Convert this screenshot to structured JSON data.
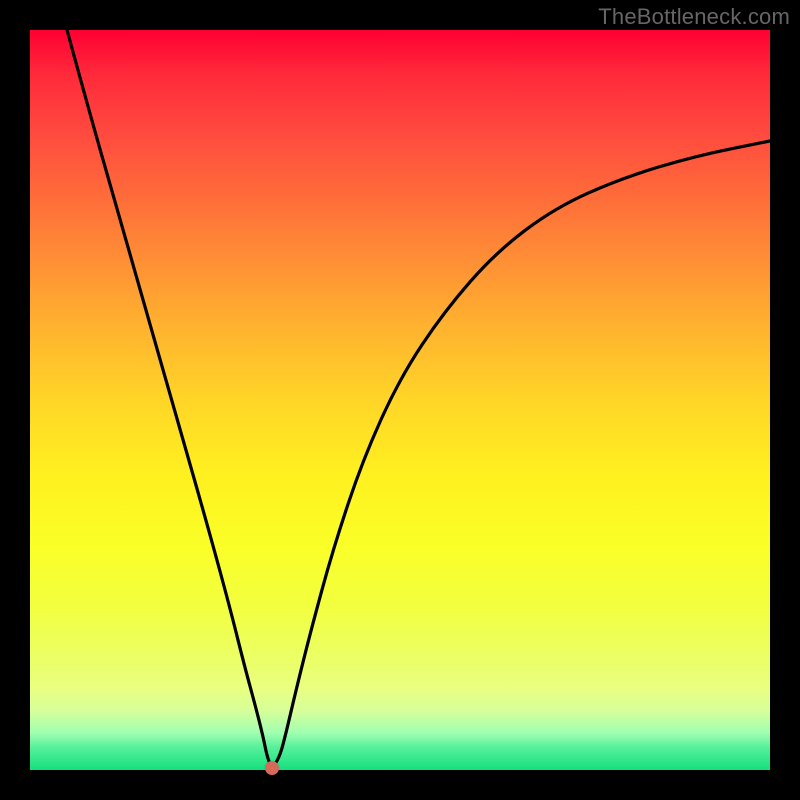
{
  "watermark": "TheBottleneck.com",
  "chart_data": {
    "type": "line",
    "title": "",
    "xlabel": "",
    "ylabel": "",
    "xlim": [
      0,
      100
    ],
    "ylim": [
      0,
      100
    ],
    "grid": false,
    "legend": false,
    "series": [
      {
        "name": "curve",
        "color": "#000000",
        "x": [
          5,
          8,
          12,
          16,
          20,
          24,
          27,
          29,
          30.5,
          31.5,
          32,
          32.5,
          33,
          33.8,
          34.6,
          36,
          38,
          41,
          45,
          50,
          56,
          63,
          71,
          80,
          90,
          100
        ],
        "y": [
          100,
          89,
          75,
          61,
          47,
          33,
          22,
          14,
          8.5,
          4.5,
          2,
          0.6,
          0.6,
          2,
          5,
          11,
          19,
          30,
          42,
          53,
          62,
          70,
          76,
          80,
          83,
          85
        ]
      }
    ],
    "marker": {
      "x": 32.7,
      "y": 0.3,
      "color": "#d66a5a"
    },
    "background_gradient": {
      "top": "#ff0033",
      "bottom": "#14e07e"
    }
  }
}
